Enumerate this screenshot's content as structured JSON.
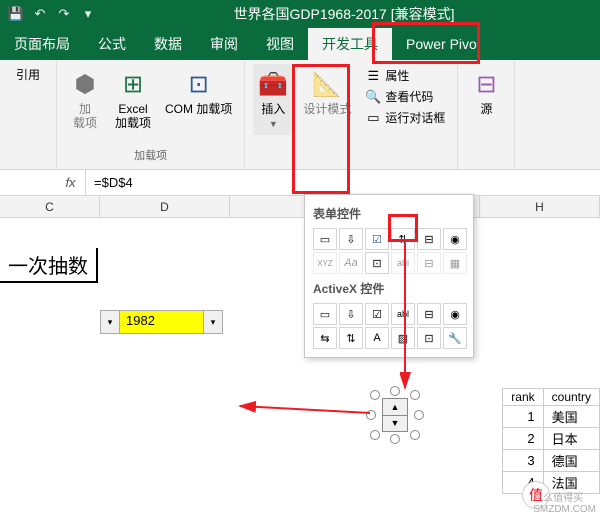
{
  "title": "世界各国GDP1968-2017  [兼容模式]",
  "tabs": {
    "layout": "页面布局",
    "formulas": "公式",
    "data": "数据",
    "review": "审阅",
    "view": "视图",
    "developer": "开发工具",
    "powerpivot": "Power Pivo"
  },
  "ribbon": {
    "ref": "引用",
    "addin": "加\n载项",
    "excel_addin": "Excel\n加载项",
    "com_addin": "COM 加载项",
    "addins_group": "加载项",
    "insert": "插入",
    "design_mode": "设计模式",
    "properties": "属性",
    "view_code": "查看代码",
    "run_dialog": "运行对话框",
    "source": "源"
  },
  "popup": {
    "form_controls": "表单控件",
    "activex_controls": "ActiveX 控件",
    "xyz": "XYZ",
    "aa": "Aa",
    "abl": "abl"
  },
  "formula": {
    "fx": "fx",
    "value": "=$D$4"
  },
  "cols": {
    "c": "C",
    "d": "D",
    "h": "H"
  },
  "sheet": {
    "label_once": "一次抽数",
    "year": "1982"
  },
  "rank": {
    "h_rank": "rank",
    "h_country": "country",
    "rows": [
      {
        "n": "1",
        "c": "美国"
      },
      {
        "n": "2",
        "c": "日本"
      },
      {
        "n": "3",
        "c": "德国"
      },
      {
        "n": "4",
        "c": "法国"
      }
    ]
  },
  "watermark": {
    "text": "什么值得买\nSMZDM.COM",
    "badge": "值"
  }
}
